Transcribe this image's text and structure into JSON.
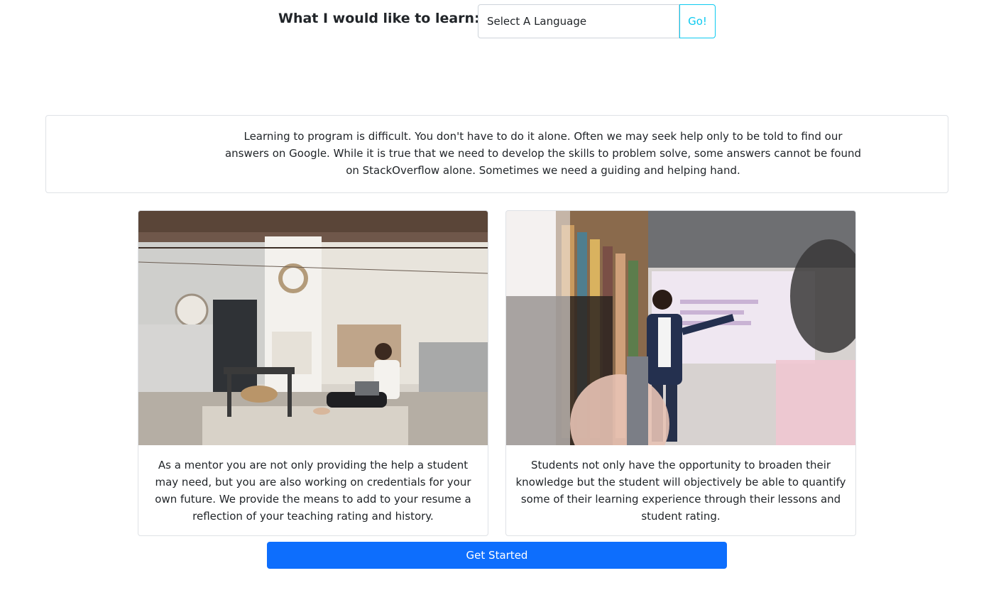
{
  "search": {
    "label": "What I would like to learn:",
    "select_value": "Select A Language",
    "go_label": "Go!"
  },
  "intro": {
    "text": "Learning to program is difficult. You don't have to do it alone. Often we may seek help only to be told to find our answers on Google. While it is true that we need to develop the skills to problem solve, some answers cannot be found on StackOverflow alone. Sometimes we need a guiding and helping hand."
  },
  "cards": [
    {
      "image": "woman-working-on-laptop-in-living-room-photo",
      "text": "As a mentor you are not only providing the help a student may need, but you are also working on credentials for your own future. We provide the means to add to your resume a reflection of your teaching rating and history."
    },
    {
      "image": "man-presenting-to-audience-photo",
      "text": "Students not only have the opportunity to broaden their knowledge but the student will objectively be able to quantify some of their learning experience through their lessons and student rating."
    }
  ],
  "cta": {
    "label": "Get Started"
  },
  "colors": {
    "primary": "#0d6efd",
    "info": "#0dcaf0",
    "border": "#dfe2e6",
    "text": "#212529"
  }
}
